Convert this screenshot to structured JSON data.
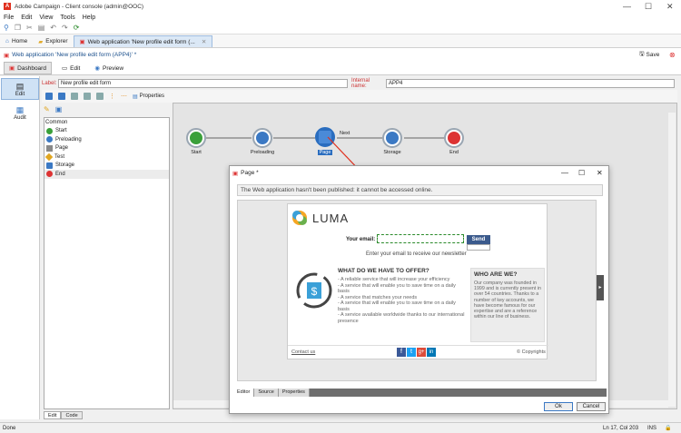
{
  "window": {
    "title": "Adobe Campaign - Client console (admin@OOC)",
    "minimize": "—",
    "maximize": "☐",
    "close": "✕"
  },
  "menu": {
    "items": [
      "File",
      "Edit",
      "View",
      "Tools",
      "Help"
    ]
  },
  "tabs": {
    "home": "Home",
    "explorer": "Explorer",
    "webapp": "Web application 'New profile edit form (..."
  },
  "document": {
    "title": "Web application 'New profile edit form (APP4)' *",
    "save": "Save"
  },
  "subtabs": {
    "dashboard": "Dashboard",
    "edit": "Edit",
    "preview": "Preview"
  },
  "leftnav": {
    "edit": "Edit",
    "audit": "Audit"
  },
  "form": {
    "label_caption": "Label:",
    "label_value": "New profile edit form",
    "internal_caption": "Internal name:",
    "internal_value": "APP4"
  },
  "toolbar": {
    "properties": "Properties"
  },
  "palette": {
    "group": "Common",
    "items": [
      "Start",
      "Preloading",
      "Page",
      "Test",
      "Storage",
      "End"
    ]
  },
  "workflow": {
    "nodes": [
      "Start",
      "Preloading",
      "Page",
      "Storage",
      "End"
    ],
    "transition": "Next"
  },
  "dialog": {
    "title": "Page *",
    "warning": "The Web application hasn't been published: it cannot be accessed online.",
    "luma": {
      "brand": "LUMA",
      "email_label": "Your email:",
      "send": "Send",
      "hint": "Enter your email to receive our newsletter",
      "offer_title": "WHAT DO WE HAVE TO OFFER?",
      "offers": [
        "- A reliable service that will increase your efficiency",
        "- A service that will enable you to save time on a daily basis",
        "- A service that matches your needs",
        "- A service that will enable you to save time on a daily basis",
        "- A service available worldwide thanks to our international presence"
      ],
      "who_title": "WHO ARE WE?",
      "who_text": "Our company was founded in 1999 and is currently present in over 54 countries. Thanks to a number of key accounts, we have become famous for our expertise and are a reference within our line of business.",
      "contact": "Contact us",
      "copyright": "© Copyrights"
    },
    "bottom_tabs": [
      "Editor",
      "Source",
      "Properties"
    ],
    "ok": "Ok",
    "cancel": "Cancel"
  },
  "edit_tabs": [
    "Edit",
    "Code"
  ],
  "status": {
    "left": "Done",
    "position": "Ln 17, Col 203",
    "mode": "INS"
  }
}
